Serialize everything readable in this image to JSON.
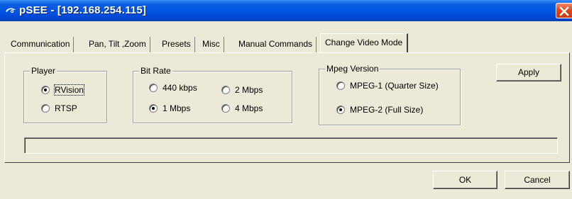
{
  "window": {
    "title": "pSEE - [192.168.254.115]",
    "title_color": "#0054e3",
    "close_color": "#e0491f"
  },
  "tabs": [
    {
      "label": "Communication",
      "active": false
    },
    {
      "label": "Pan, Tilt ,Zoom",
      "active": false
    },
    {
      "label": "Presets",
      "active": false
    },
    {
      "label": "Misc",
      "active": false
    },
    {
      "label": "Manual Commands",
      "active": false
    },
    {
      "label": "Change Video Mode",
      "active": true
    }
  ],
  "player": {
    "label": "Player",
    "options": [
      {
        "label": "RVision",
        "selected": true
      },
      {
        "label": "RTSP",
        "selected": false
      }
    ]
  },
  "bitrate": {
    "label": "Bit Rate",
    "options": [
      {
        "label": "440 kbps",
        "selected": false
      },
      {
        "label": "2 Mbps",
        "selected": false
      },
      {
        "label": "1 Mbps",
        "selected": true
      },
      {
        "label": "4 Mbps",
        "selected": false
      }
    ]
  },
  "mpeg": {
    "label": "Mpeg Version",
    "options": [
      {
        "label": "MPEG-1 (Quarter Size)",
        "selected": false
      },
      {
        "label": "MPEG-2 (Full Size)",
        "selected": true
      }
    ]
  },
  "buttons": {
    "apply": "Apply",
    "ok": "OK",
    "cancel": "Cancel"
  },
  "status": ""
}
